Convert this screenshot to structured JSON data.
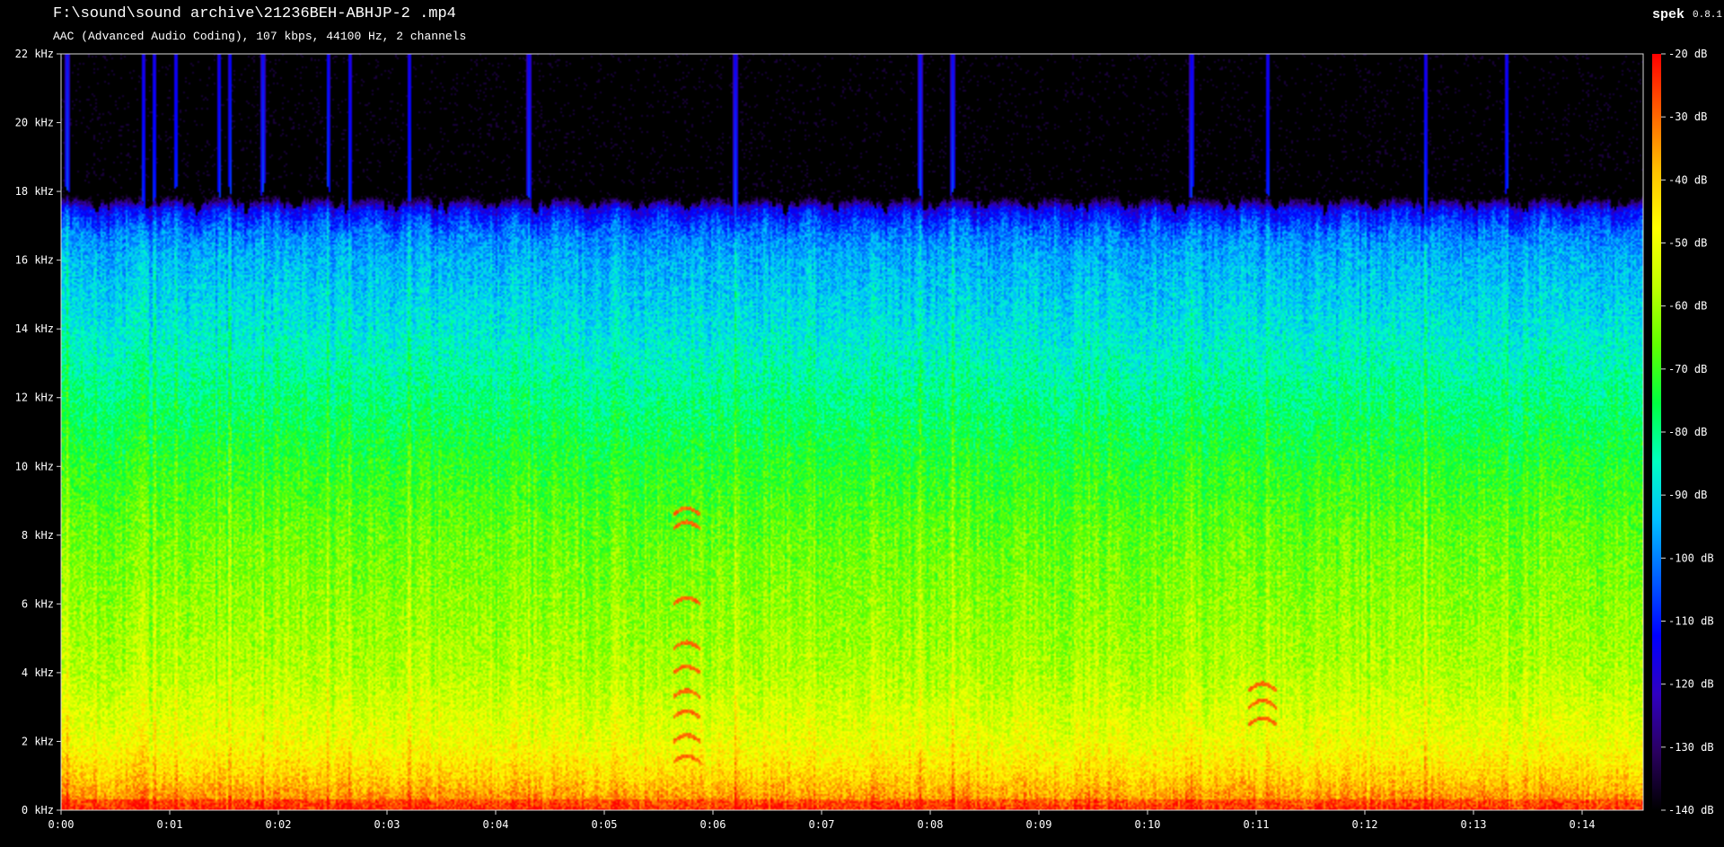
{
  "header": {
    "file_path": "F:\\sound\\sound archive\\21236BEH-ABHJP-2 .mp4",
    "stream_info": "AAC (Advanced Audio Coding), 107 kbps, 44100 Hz, 2 channels",
    "app_name": "spek",
    "app_version": "0.8.1"
  },
  "chart_data": {
    "type": "heatmap",
    "title": "",
    "xlabel": "",
    "ylabel": "",
    "x_unit": "time",
    "y_unit": "kHz",
    "z_unit": "dB",
    "xlim": [
      "0:00",
      "0:14.6"
    ],
    "ylim": [
      0,
      22
    ],
    "zlim": [
      -140,
      -20
    ],
    "x_ticks": [
      "0:00",
      "0:01",
      "0:02",
      "0:03",
      "0:04",
      "0:05",
      "0:06",
      "0:07",
      "0:08",
      "0:09",
      "0:10",
      "0:11",
      "0:12",
      "0:13",
      "0:14"
    ],
    "y_ticks": [
      "0 kHz",
      "2 kHz",
      "4 kHz",
      "6 kHz",
      "8 kHz",
      "10 kHz",
      "12 kHz",
      "14 kHz",
      "16 kHz",
      "18 kHz",
      "20 kHz",
      "22 kHz"
    ],
    "colorbar_ticks": [
      "-20 dB",
      "-30 dB",
      "-40 dB",
      "-50 dB",
      "-60 dB",
      "-70 dB",
      "-80 dB",
      "-90 dB",
      "-100 dB",
      "-110 dB",
      "-120 dB",
      "-130 dB",
      "-140 dB"
    ],
    "colormap": [
      "#000000",
      "#2a0060",
      "#3000c0",
      "#0000ff",
      "#0060ff",
      "#00c0ff",
      "#00ffc0",
      "#00ff40",
      "#60ff00",
      "#c0ff00",
      "#ffff00",
      "#ffc000",
      "#ff6000",
      "#ff0000"
    ],
    "levels_by_frequency": {
      "frequency_khz": [
        0,
        1,
        2,
        4,
        6,
        8,
        10,
        12,
        14,
        16,
        17.5,
        18,
        22
      ],
      "level_db": [
        -30,
        -42,
        -50,
        -58,
        -62,
        -66,
        -72,
        -80,
        -88,
        -95,
        -105,
        -140,
        -140
      ]
    },
    "cutoff_khz": 17.8,
    "vertical_streaks_s": [
      0.05,
      0.75,
      0.85,
      1.05,
      1.45,
      1.55,
      1.85,
      2.45,
      2.65,
      3.2,
      4.3,
      6.2,
      7.9,
      8.2,
      10.4,
      11.1,
      12.55,
      13.3
    ],
    "tonal_arcs": [
      {
        "time_s": 5.75,
        "harmonics_khz": [
          1.4,
          2.0,
          2.7,
          3.3,
          4.0,
          4.7,
          6.0,
          8.2,
          8.6
        ]
      },
      {
        "time_s": 11.05,
        "harmonics_khz": [
          2.5,
          3.0,
          3.5
        ]
      }
    ]
  }
}
